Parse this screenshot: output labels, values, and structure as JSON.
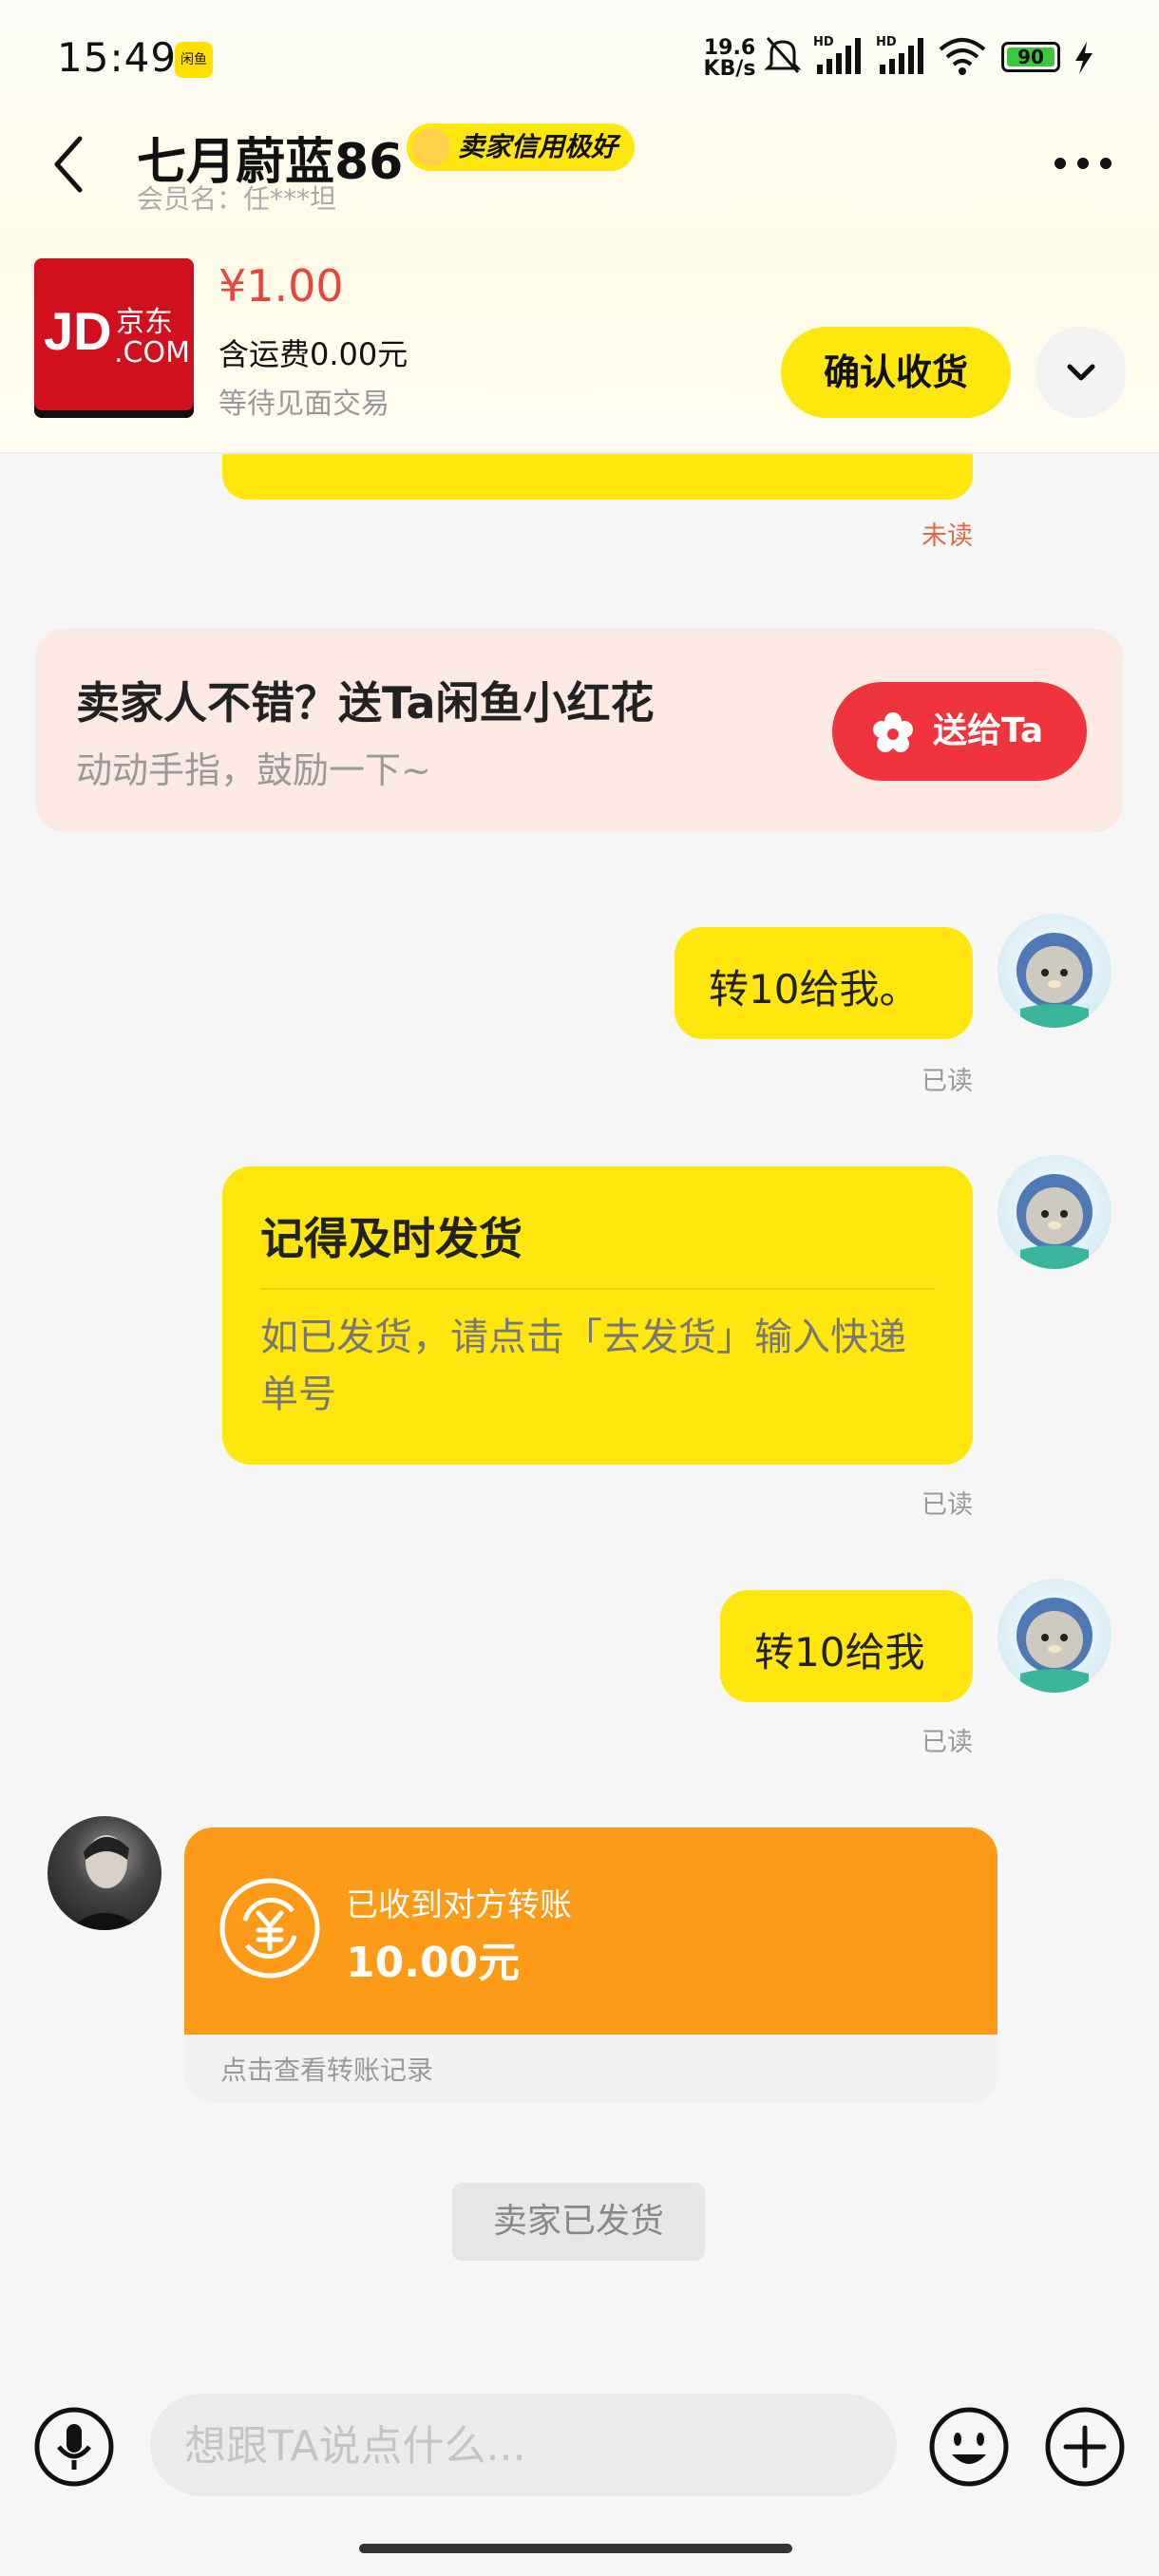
{
  "status_bar": {
    "time": "15:49",
    "app_badge": "闲鱼",
    "net_speed_value": "19.6",
    "net_speed_unit": "KB/s",
    "battery": "90"
  },
  "header": {
    "title": "七月蔚蓝86",
    "badge": "卖家信用极好",
    "member_label": "会员名：任***坦"
  },
  "product": {
    "logo_jd": "JD",
    "logo_cn": "京东",
    "logo_com": ".COM",
    "price": "¥1.00",
    "shipping": "含运费0.00元",
    "status": "等待见面交易",
    "confirm_button": "确认收货"
  },
  "messages": {
    "partial_status": "未读",
    "flower_card": {
      "title": "卖家人不错？送Ta闲鱼小红花",
      "subtitle": "动动手指，鼓励一下~",
      "button": "送给Ta"
    },
    "msg1": {
      "text": "转10给我。",
      "status": "已读"
    },
    "card": {
      "title": "记得及时发货",
      "body": "如已发货，请点击「去发货」输入快递单号",
      "status": "已读"
    },
    "msg2": {
      "text": "转10给我",
      "status": "已读"
    },
    "transfer": {
      "label": "已收到对方转账",
      "amount": "10.00元",
      "link": "点击查看转账记录"
    },
    "system_tip": "卖家已发货"
  },
  "input": {
    "placeholder": "想跟TA说点什么..."
  },
  "colors": {
    "accent_yellow": "#ffe60f",
    "price_red": "#e8463c",
    "flower_red": "#f0343e",
    "transfer_orange": "#fd9a18"
  }
}
